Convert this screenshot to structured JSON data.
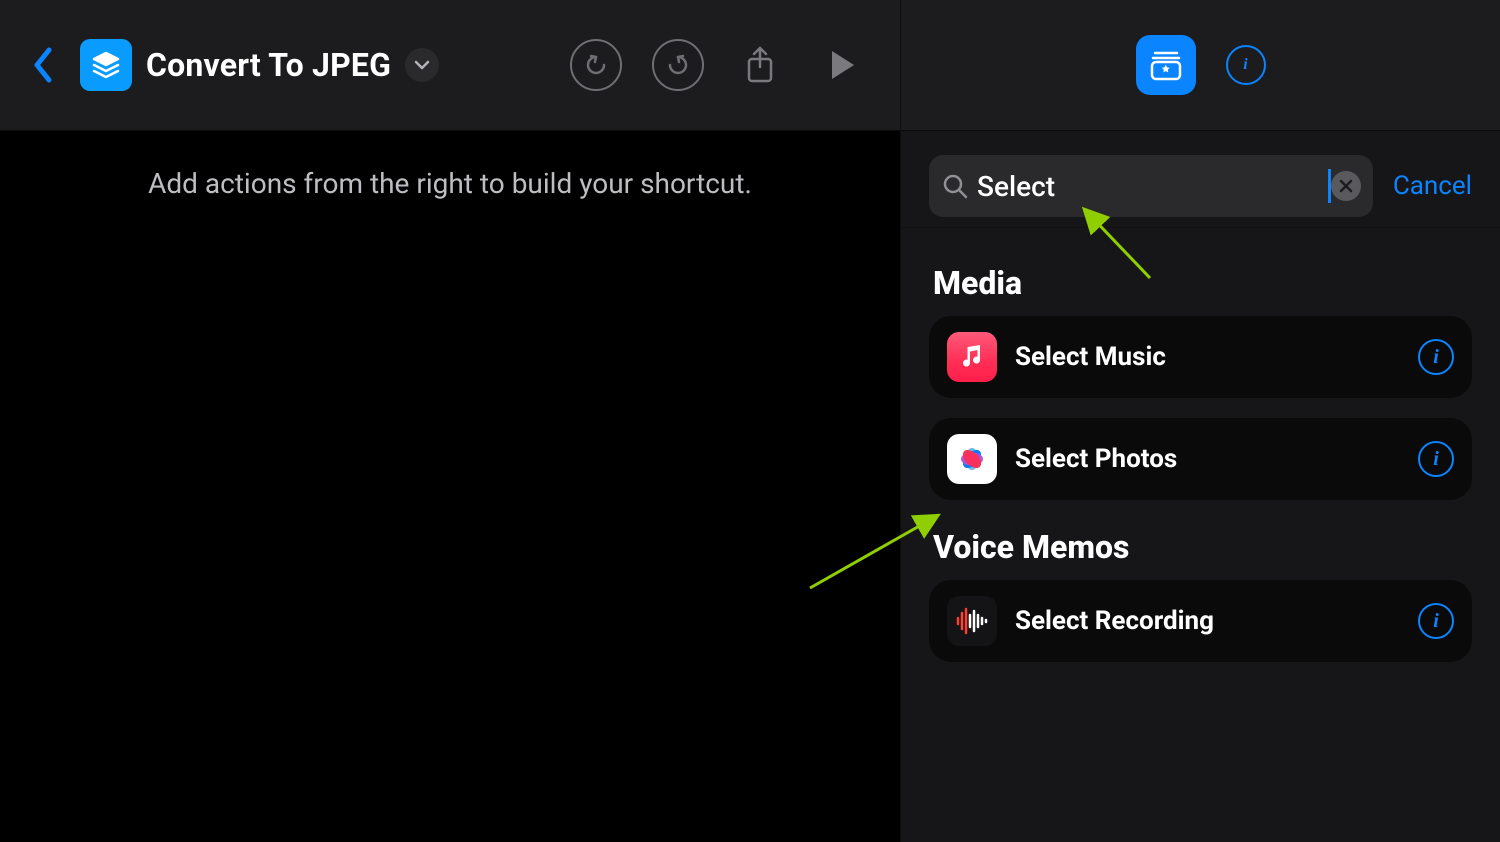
{
  "header": {
    "title": "Convert To JPEG"
  },
  "hint_text": "Add actions from the right to build your shortcut.",
  "search": {
    "value": "Select",
    "cancel_label": "Cancel"
  },
  "sections": [
    {
      "title": "Media",
      "items": [
        {
          "id": "select-music",
          "label": "Select Music",
          "icon": "music"
        },
        {
          "id": "select-photos",
          "label": "Select Photos",
          "icon": "photos"
        }
      ]
    },
    {
      "title": "Voice Memos",
      "items": [
        {
          "id": "select-recording",
          "label": "Select Recording",
          "icon": "voice"
        }
      ]
    }
  ]
}
